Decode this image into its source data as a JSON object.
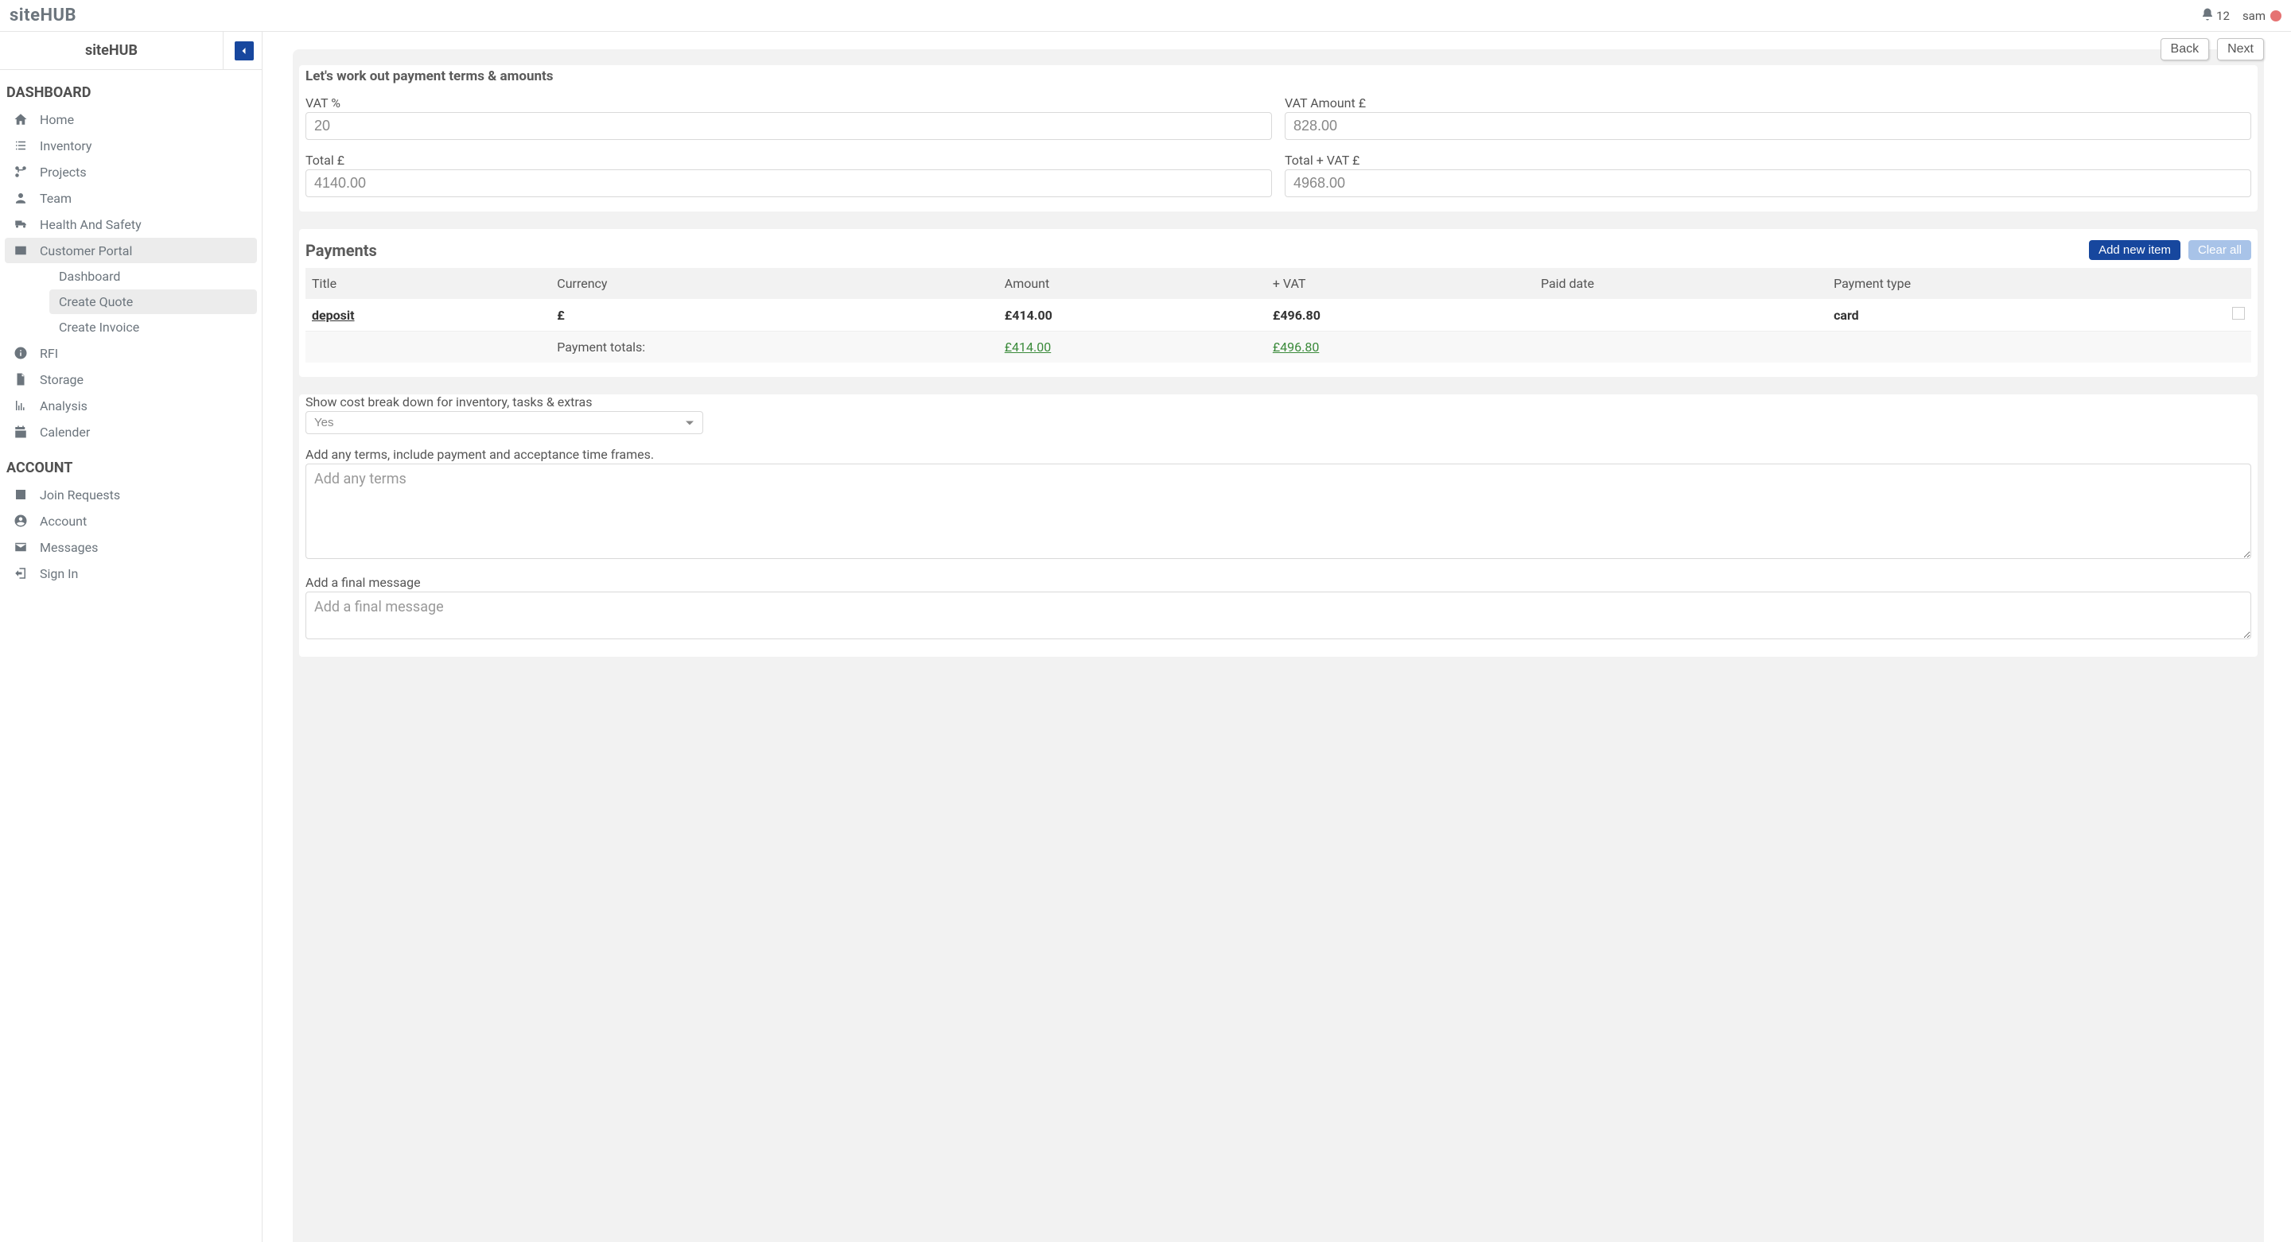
{
  "brand": "siteHUB",
  "notifications_count": "12",
  "user_name": "sam",
  "sidebar": {
    "title": "siteHUB",
    "sections": {
      "dashboard_label": "DASHBOARD",
      "account_label": "ACCOUNT"
    },
    "dashboard_items": [
      {
        "label": "Home"
      },
      {
        "label": "Inventory"
      },
      {
        "label": "Projects"
      },
      {
        "label": "Team"
      },
      {
        "label": "Health And Safety"
      },
      {
        "label": "Customer Portal"
      },
      {
        "label": "RFI"
      },
      {
        "label": "Storage"
      },
      {
        "label": "Analysis"
      },
      {
        "label": "Calender"
      }
    ],
    "customer_portal_sub": [
      {
        "label": "Dashboard"
      },
      {
        "label": "Create Quote"
      },
      {
        "label": "Create Invoice"
      }
    ],
    "account_items": [
      {
        "label": "Join Requests"
      },
      {
        "label": "Account"
      },
      {
        "label": "Messages"
      },
      {
        "label": "Sign In"
      }
    ]
  },
  "wizard": {
    "back_label": "Back",
    "next_label": "Next",
    "heading": "Let's work out payment terms & amounts",
    "vat_pct_label": "VAT %",
    "vat_pct_value": "20",
    "vat_amount_label": "VAT Amount £",
    "vat_amount_value": "828.00",
    "total_label": "Total £",
    "total_value": "4140.00",
    "total_vat_label": "Total + VAT £",
    "total_vat_value": "4968.00"
  },
  "payments": {
    "heading": "Payments",
    "add_label": "Add new item",
    "clear_label": "Clear all",
    "columns": {
      "title": "Title",
      "currency": "Currency",
      "amount": "Amount",
      "plus_vat": "+ VAT",
      "paid_date": "Paid date",
      "payment_type": "Payment type"
    },
    "rows": [
      {
        "title": "deposit",
        "currency": "£",
        "amount": "£414.00",
        "plus_vat": "£496.80",
        "paid_date": "",
        "payment_type": "card"
      }
    ],
    "totals_label": "Payment totals:",
    "totals_amount": "£414.00",
    "totals_plus_vat": "£496.80"
  },
  "breakdown": {
    "label": "Show cost break down for inventory, tasks & extras",
    "selected": "Yes"
  },
  "terms": {
    "label": "Add any terms, include payment and acceptance time frames.",
    "placeholder": "Add any terms"
  },
  "final_message": {
    "label": "Add a final message",
    "placeholder": "Add a final message"
  }
}
